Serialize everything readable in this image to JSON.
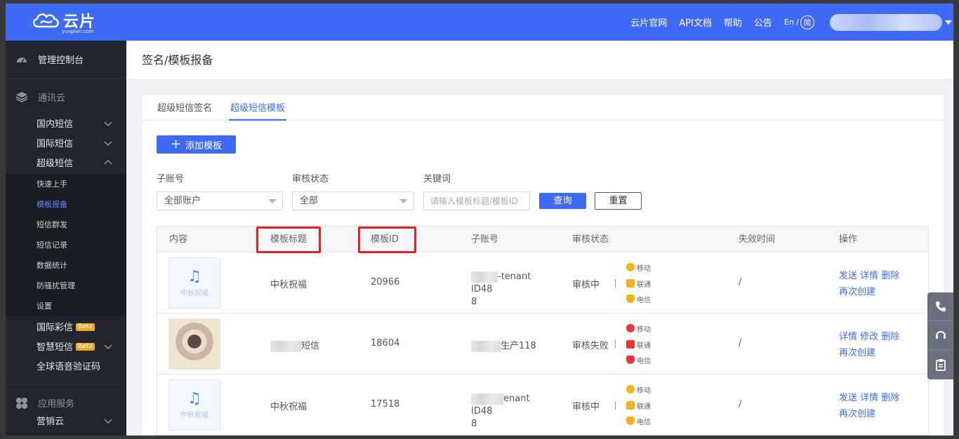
{
  "brand": {
    "name": "云片",
    "domain": "yunpian.com"
  },
  "topnav": {
    "links": [
      "云片官网",
      "API文档",
      "帮助",
      "公告"
    ],
    "lang_en": "En /",
    "lang_zh": "简"
  },
  "sidebar": {
    "console": "管理控制台",
    "group_comm": "通讯云",
    "domestic_sms": "国内短信",
    "intl_sms": "国际短信",
    "super_sms": "超级短信",
    "super_sub": [
      "快速上手",
      "模板报备",
      "短信群发",
      "短信记录",
      "数据统计",
      "防骚扰管理",
      "设置"
    ],
    "intl_mms": "国际彩信",
    "smart_sms": "智慧短信",
    "beta": "Beta",
    "global_voice": "全球语音验证码",
    "group_app": "应用服务",
    "marketing": "营销云"
  },
  "page": {
    "title": "签名/模板报备"
  },
  "tabs": [
    "超级短信签名",
    "超级短信模板"
  ],
  "toolbar": {
    "add_label": "添加模板",
    "sub_account_label": "子账号",
    "sub_account_value": "全部账户",
    "status_label": "审核状态",
    "status_value": "全部",
    "keyword_label": "关键词",
    "keyword_placeholder": "请输入模板标题/模板ID",
    "query_label": "查询",
    "reset_label": "重置"
  },
  "table": {
    "headers": [
      "内容",
      "模板标题",
      "模板ID",
      "子账号",
      "审核状态",
      "失效时间",
      "操作"
    ],
    "thumb_label": "中秋祝福",
    "carriers": [
      "移动",
      "联通",
      "电信"
    ],
    "rows": [
      {
        "title": "中秋祝福",
        "id": "20966",
        "account_a": "-tenant ID48",
        "account_b": "8",
        "status": "审核中",
        "expire": "/",
        "op1": "发送",
        "op2": "详情",
        "op3": "删除",
        "op4": "再次创建"
      },
      {
        "title": "短信",
        "id": "18604",
        "account_a": "生产118",
        "account_b": "",
        "status": "审核失败",
        "expire": "/",
        "op1": "详情",
        "op2": "修改",
        "op3": "删除",
        "op4": "再次创建"
      },
      {
        "title": "中秋祝福",
        "id": "17518",
        "account_a": "enant ID48",
        "account_b": "8",
        "status": "审核中",
        "expire": "/",
        "op1": "发送",
        "op2": "详情",
        "op3": "删除",
        "op4": "再次创建"
      }
    ]
  },
  "colors": {
    "primary": "#3f6af5",
    "sidebar": "#222530",
    "highlight": "#e82020"
  }
}
